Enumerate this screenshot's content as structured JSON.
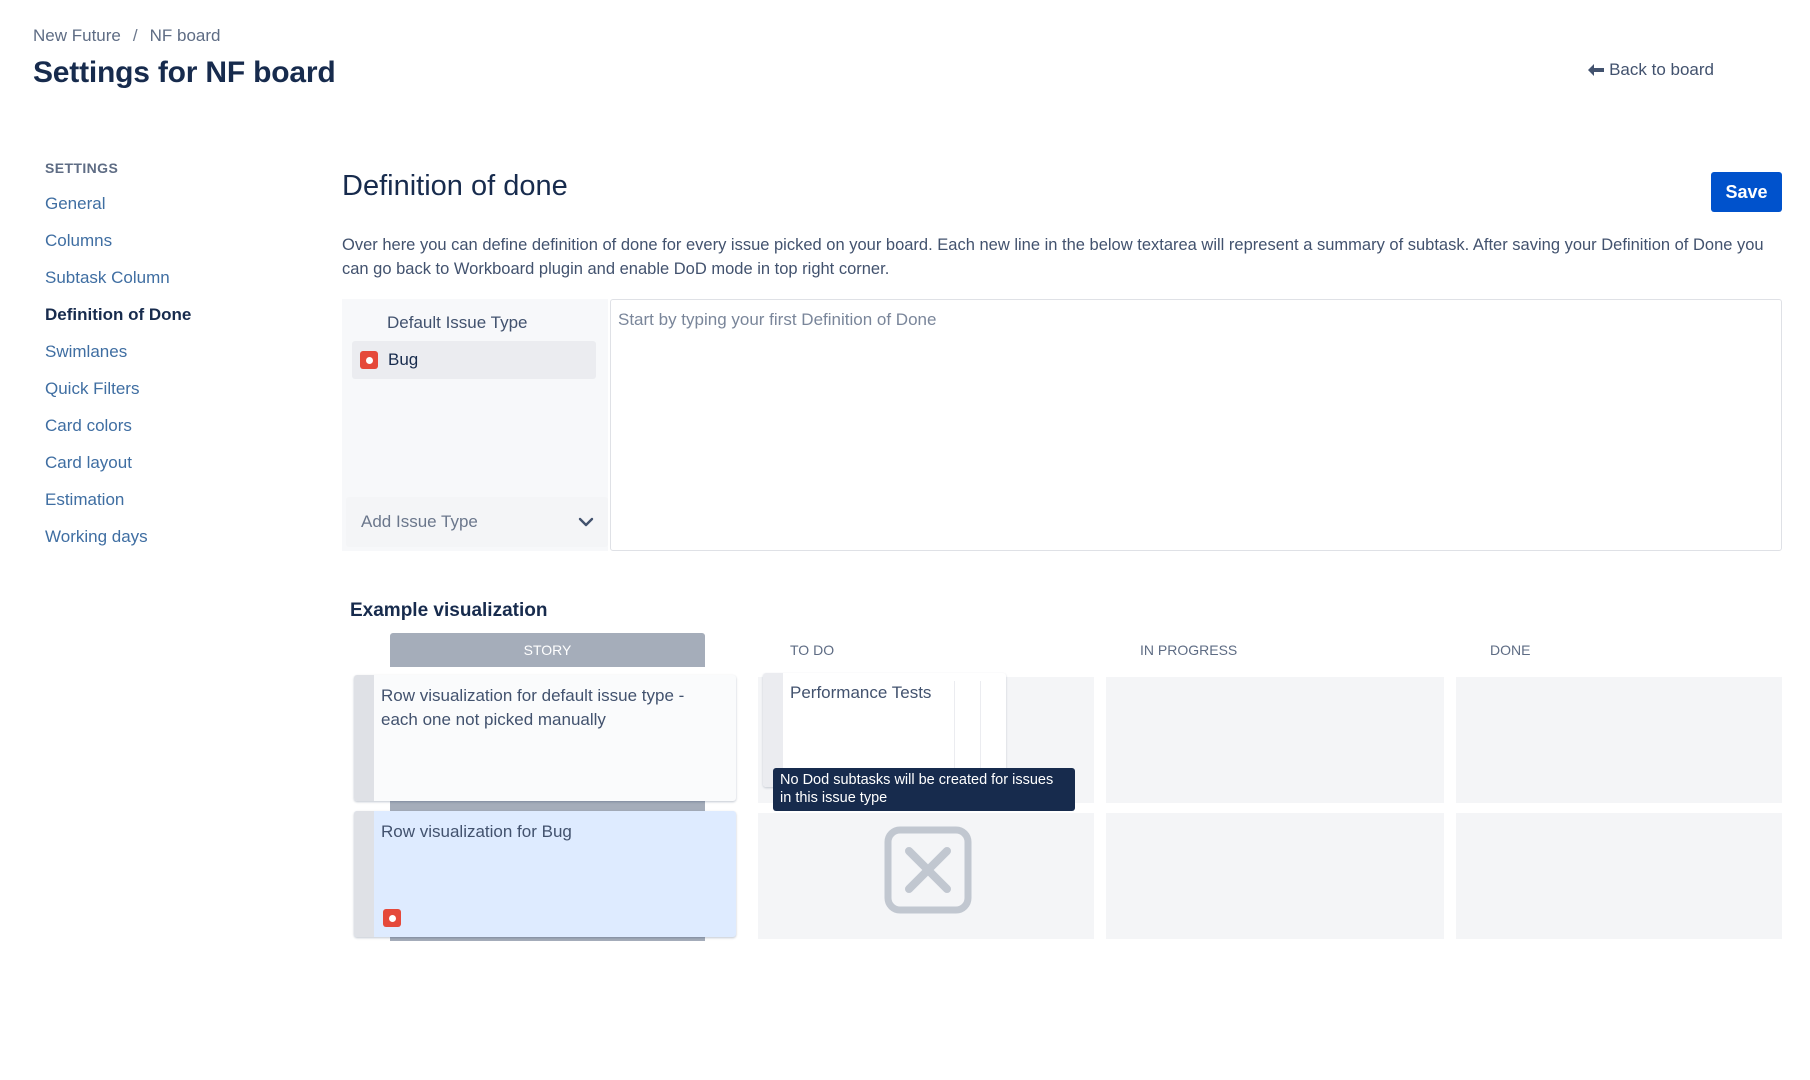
{
  "breadcrumb": {
    "items": [
      "New Future",
      "NF board"
    ],
    "separator": "/"
  },
  "page": {
    "title": "Settings for NF board",
    "back_label": "Back to board"
  },
  "sidebar": {
    "heading": "SETTINGS",
    "items": [
      {
        "label": "General",
        "active": false
      },
      {
        "label": "Columns",
        "active": false
      },
      {
        "label": "Subtask Column",
        "active": false
      },
      {
        "label": "Definition of Done",
        "active": true
      },
      {
        "label": "Swimlanes",
        "active": false
      },
      {
        "label": "Quick Filters",
        "active": false
      },
      {
        "label": "Card colors",
        "active": false
      },
      {
        "label": "Card layout",
        "active": false
      },
      {
        "label": "Estimation",
        "active": false
      },
      {
        "label": "Working days",
        "active": false
      }
    ]
  },
  "main": {
    "title": "Definition of done",
    "save_label": "Save",
    "description": "Over here you can define definition of done for every issue picked on your board. Each new line in the below textarea will represent a summary of subtask. After saving your Definition of Done you can go back to Workboard plugin and enable DoD mode in top right corner."
  },
  "issue_panel": {
    "default_label": "Default Issue Type",
    "issue_types": [
      {
        "label": "Bug",
        "icon": "bug-icon"
      }
    ],
    "add_placeholder": "Add Issue Type"
  },
  "textarea": {
    "placeholder": "Start by typing your first Definition of Done",
    "value": ""
  },
  "visualization": {
    "title": "Example visualization",
    "columns": [
      "STORY",
      "TO DO",
      "IN PROGRESS",
      "DONE"
    ],
    "rows": [
      {
        "label": "Row visualization for default issue type - each one not picked manually"
      },
      {
        "label": "Row visualization for Bug"
      }
    ],
    "task_card": "Performance Tests",
    "tooltip": "No Dod subtasks will be created for issues in this issue type"
  },
  "colors": {
    "primary": "#0052cc",
    "text": "#172b4d",
    "link": "#3f6ea2",
    "bug": "#e5493a",
    "tooltip_bg": "#172b4d",
    "highlight_row": "#deebff"
  }
}
